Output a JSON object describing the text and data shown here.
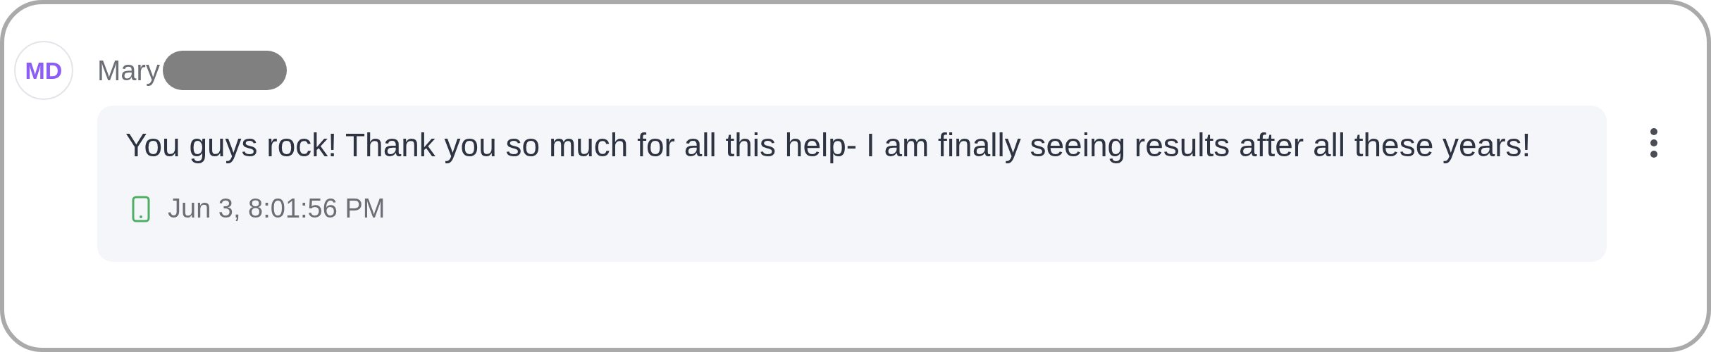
{
  "author": {
    "initials": "MD",
    "name": "Mary"
  },
  "message": {
    "text": "You guys rock! Thank you so much for all this help- I am finally seeing results after all these years!",
    "kind": "phone",
    "timestamp": "Jun 3, 8:01:56 PM"
  }
}
